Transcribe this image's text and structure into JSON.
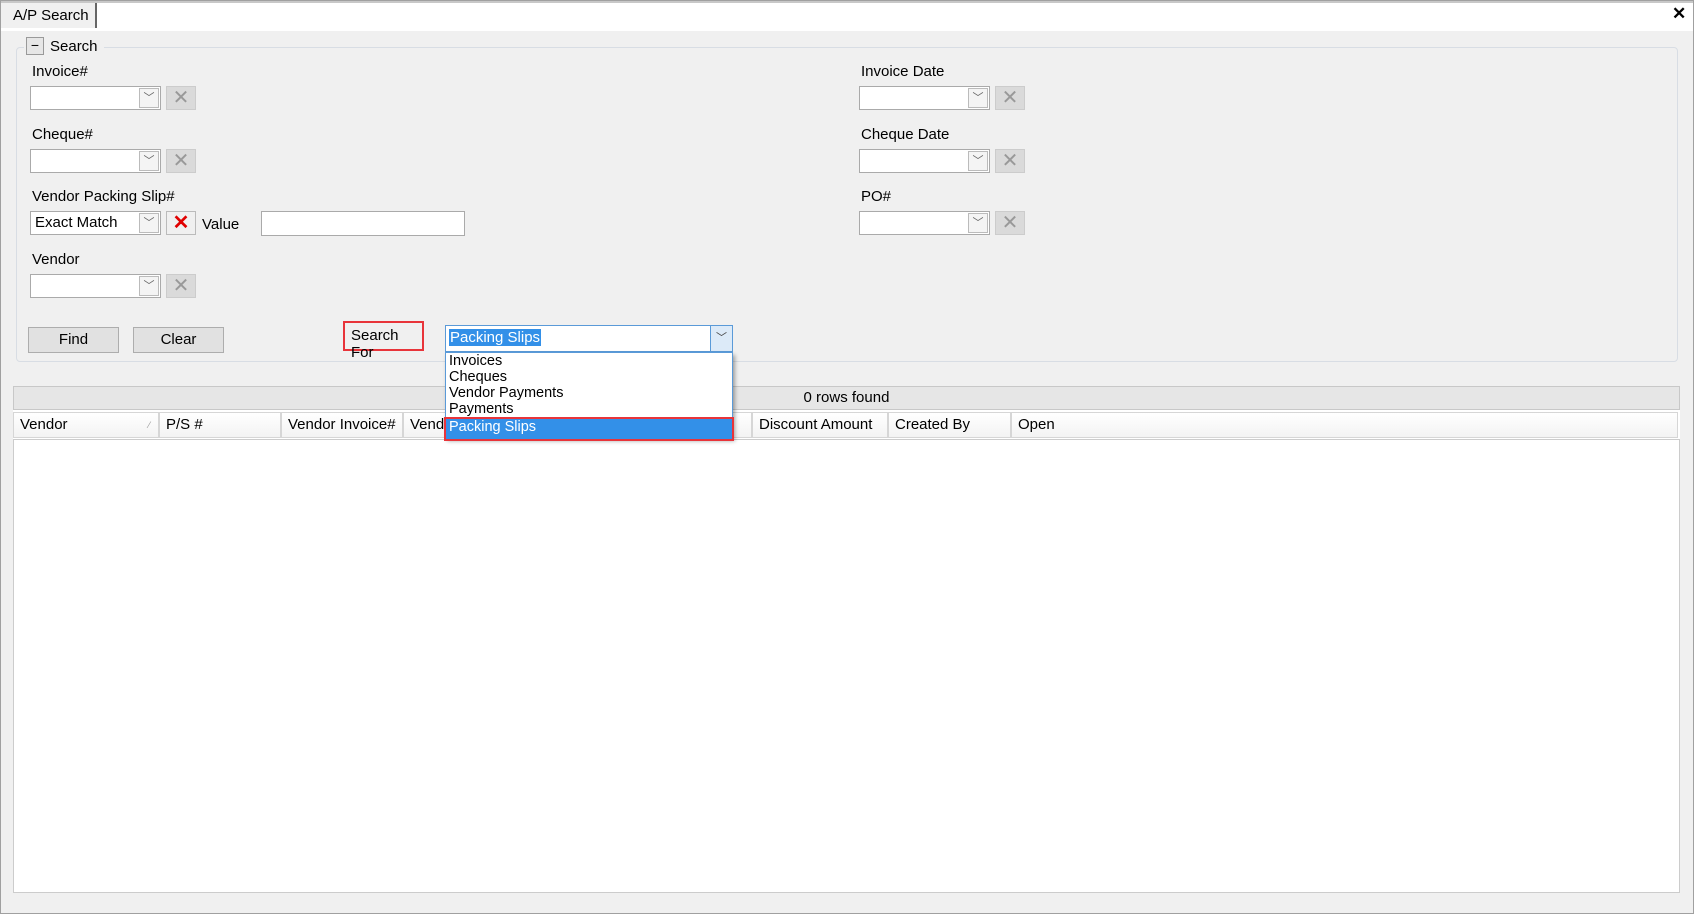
{
  "window": {
    "tab_title": "A/P Search",
    "close_icon": "close-icon"
  },
  "search_group": {
    "title": "Search",
    "fields_left": [
      {
        "label": "Invoice#",
        "value": ""
      },
      {
        "label": "Cheque#",
        "value": ""
      },
      {
        "label": "Vendor Packing Slip#",
        "value": "Exact Match",
        "value_label": "Value",
        "value_text": ""
      },
      {
        "label": "Vendor",
        "value": ""
      }
    ],
    "fields_right": [
      {
        "label": "Invoice Date",
        "value": ""
      },
      {
        "label": "Cheque Date",
        "value": ""
      },
      {
        "label": "PO#",
        "value": ""
      }
    ],
    "find_label": "Find",
    "clear_label": "Clear",
    "search_for_label": "Search For",
    "search_for_value": "Packing Slips",
    "search_for_options": [
      "Invoices",
      "Cheques",
      "Vendor Payments",
      "Payments",
      "Packing Slips"
    ],
    "highlight_color": "#e8343a",
    "selection_color": "#3390e8"
  },
  "results": {
    "status": "0 rows found",
    "columns": [
      "Vendor",
      "P/S #",
      "Vendor Invoice#",
      "Vend",
      "",
      "Discount Amount",
      "Created By",
      "Open"
    ],
    "rows": []
  }
}
